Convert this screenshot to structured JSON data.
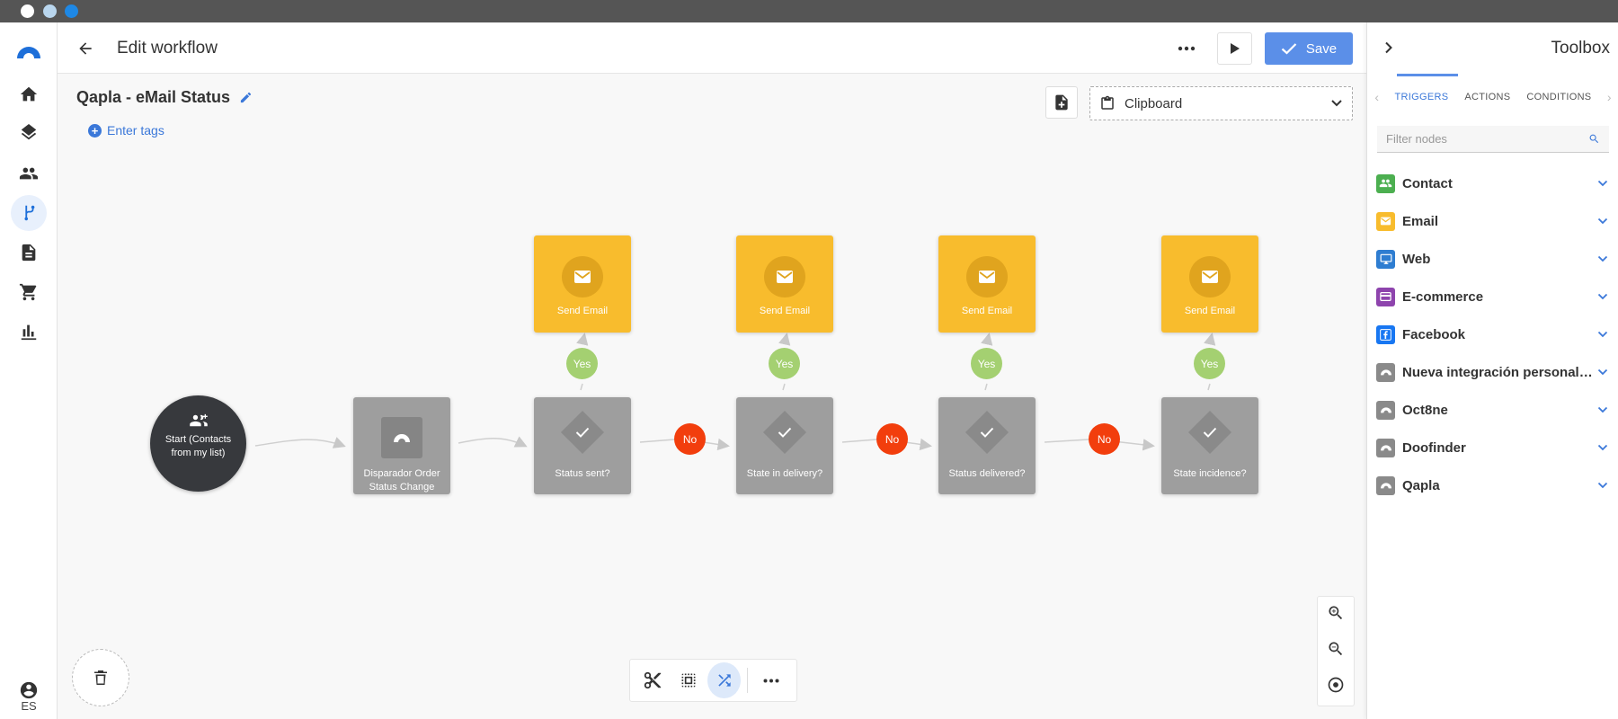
{
  "header": {
    "title": "Edit workflow",
    "save_label": "Save"
  },
  "workflow": {
    "name": "Qapla - eMail Status",
    "enter_tags": "Enter tags",
    "clipboard_label": "Clipboard"
  },
  "nodes": {
    "start": "Start (Contacts from my list)",
    "trigger": "Disparador Order Status Change",
    "conditions": [
      "Status sent?",
      "State in delivery?",
      "Status delivered?",
      "State incidence?"
    ],
    "send_email": "Send Email",
    "yes_label": "Yes",
    "no_label": "No"
  },
  "toolbox": {
    "title": "Toolbox",
    "tabs": [
      "TRIGGERS",
      "ACTIONS",
      "CONDITIONS"
    ],
    "active_tab": "TRIGGERS",
    "filter_placeholder": "Filter nodes",
    "categories": [
      {
        "label": "Contact",
        "icon": "contact-icon",
        "color": "#4caf50"
      },
      {
        "label": "Email",
        "icon": "email-icon",
        "color": "#f8bc2d"
      },
      {
        "label": "Web",
        "icon": "monitor-icon",
        "color": "#2e7dd1"
      },
      {
        "label": "E-commerce",
        "icon": "card-icon",
        "color": "#8e44ad"
      },
      {
        "label": "Facebook",
        "icon": "facebook-icon",
        "color": "#1877f2"
      },
      {
        "label": "Nueva integración personalizada",
        "icon": "integration-icon",
        "color": "#8a8a8a"
      },
      {
        "label": "Oct8ne",
        "icon": "integration-icon",
        "color": "#8a8a8a"
      },
      {
        "label": "Doofinder",
        "icon": "integration-icon",
        "color": "#8a8a8a"
      },
      {
        "label": "Qapla",
        "icon": "integration-icon",
        "color": "#8a8a8a"
      }
    ]
  },
  "sidebar": {
    "items": [
      "home-icon",
      "layers-icon",
      "people-icon",
      "workflow-icon",
      "document-icon",
      "cart-icon",
      "chart-icon"
    ],
    "active": "workflow-icon",
    "language": "ES"
  },
  "colors": {
    "accent": "#5b8fe8",
    "condition_node": "#9e9e9e",
    "action_node": "#f8bc2d",
    "yes": "#a4d071",
    "no": "#f23e0d",
    "start": "#37393d"
  }
}
